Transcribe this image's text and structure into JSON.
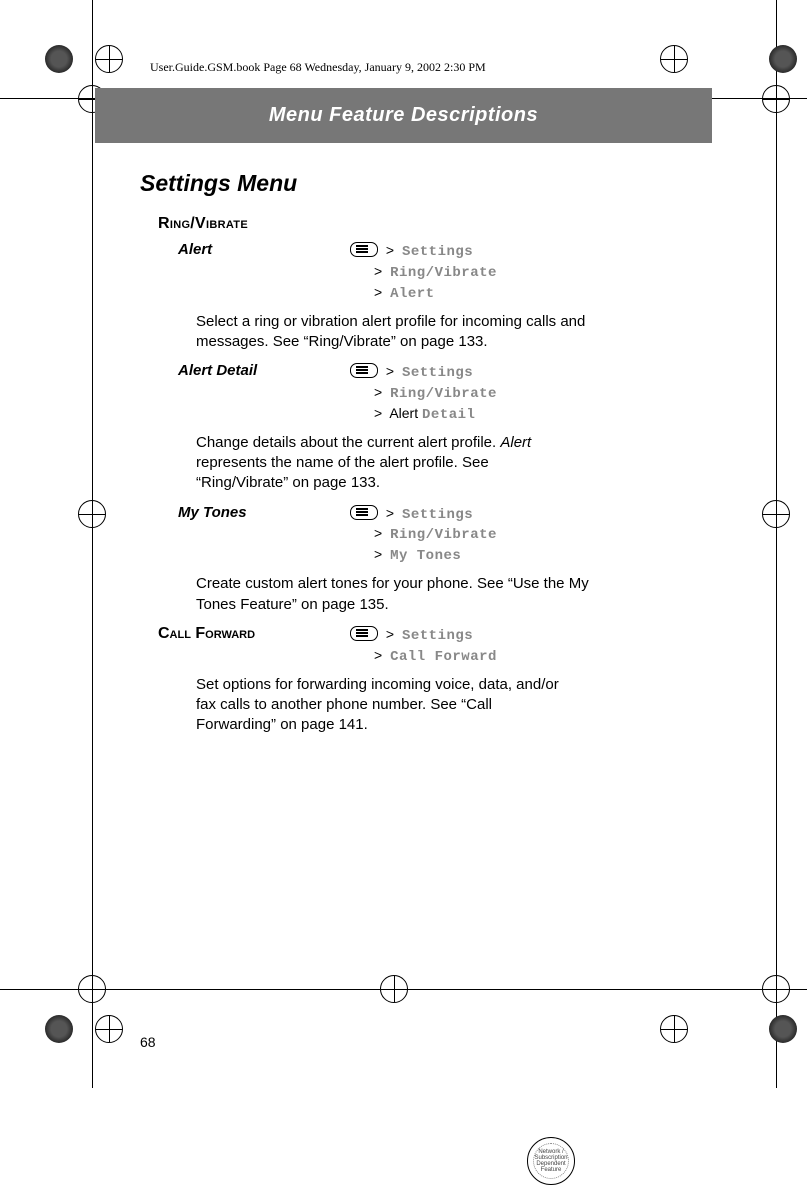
{
  "header_line": "User.Guide.GSM.book  Page 68  Wednesday, January 9, 2002  2:30 PM",
  "banner_title": "Menu Feature Descriptions",
  "page_title": "Settings Menu",
  "page_number": "68",
  "sections": {
    "ring_vibrate": {
      "heading": "Ring/Vibrate",
      "items": {
        "alert": {
          "label": "Alert",
          "nav": {
            "l1": "Settings",
            "l2": "Ring/Vibrate",
            "l3": "Alert"
          },
          "desc": "Select a ring or vibration alert profile for incoming calls and messages. See “Ring/Vibrate” on page 133."
        },
        "alert_detail": {
          "label": "Alert Detail",
          "nav": {
            "l1": "Settings",
            "l2": "Ring/Vibrate",
            "l3_pre": "Alert",
            "l3_mono": "Detail"
          },
          "desc_pre": "Change details about the current alert profile. ",
          "desc_ital": "Alert",
          "desc_post": " represents the name of the alert profile. See “Ring/Vibrate” on page 133."
        },
        "my_tones": {
          "label": "My Tones",
          "nav": {
            "l1": "Settings",
            "l2": "Ring/Vibrate",
            "l3": "My Tones"
          },
          "desc": "Create custom alert tones for your phone. See “Use the My Tones Feature” on page 135."
        }
      }
    },
    "call_forward": {
      "heading": "Call Forward",
      "nav": {
        "l1": "Settings",
        "l2": "Call Forward"
      },
      "desc": "Set options for forwarding incoming voice, data, and/or fax calls to another phone number. See “Call Forwarding” on page 141.",
      "badge_text": "Network / Subscription Dependent Feature"
    }
  }
}
